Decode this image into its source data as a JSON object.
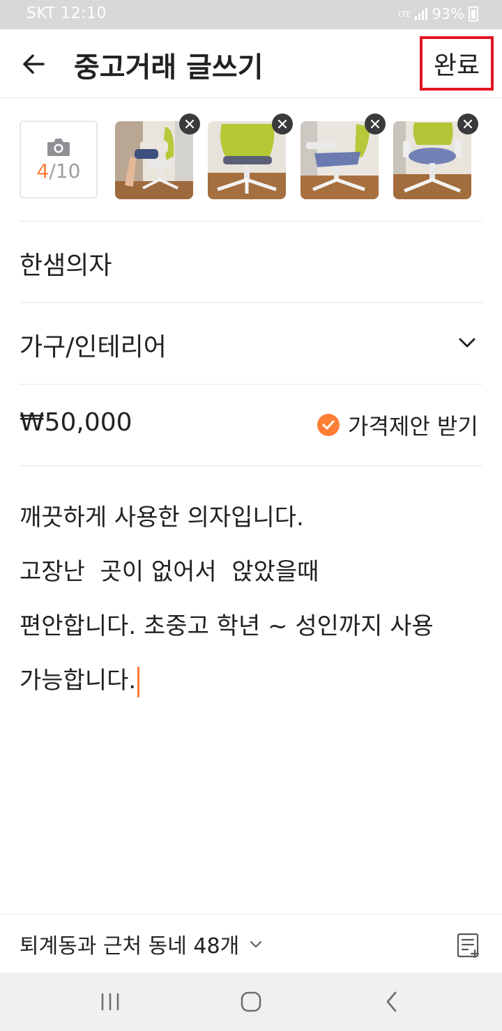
{
  "status_bar": {
    "carrier_time": "SKT 12:10",
    "network": "LTE",
    "battery": "93%"
  },
  "header": {
    "title": "중고거래 글쓰기",
    "done_label": "완료"
  },
  "photos": {
    "count_current": "4",
    "count_sep_max": "/10",
    "thumbnails": [
      "chair-photo-1",
      "chair-photo-2",
      "chair-photo-3",
      "chair-photo-4"
    ]
  },
  "form": {
    "title": "한샘의자",
    "category": "가구/인테리어",
    "price": "₩50,000",
    "price_offer_label": "가격제안 받기",
    "price_offer_checked": true,
    "description_lines": [
      "깨끗하게 사용한 의자입니다.",
      "고장난  곳이 없어서  앉았을때",
      "편안합니다. 초중고 학년 ~ 성인까지 사용",
      "가능합니다."
    ]
  },
  "bottom_bar": {
    "location_label": "퇴계동과 근처 동네 48개"
  },
  "colors": {
    "accent": "#ff7e36",
    "highlight_box": "#e3141f",
    "text": "#212124",
    "divider": "#e6e6e6"
  }
}
